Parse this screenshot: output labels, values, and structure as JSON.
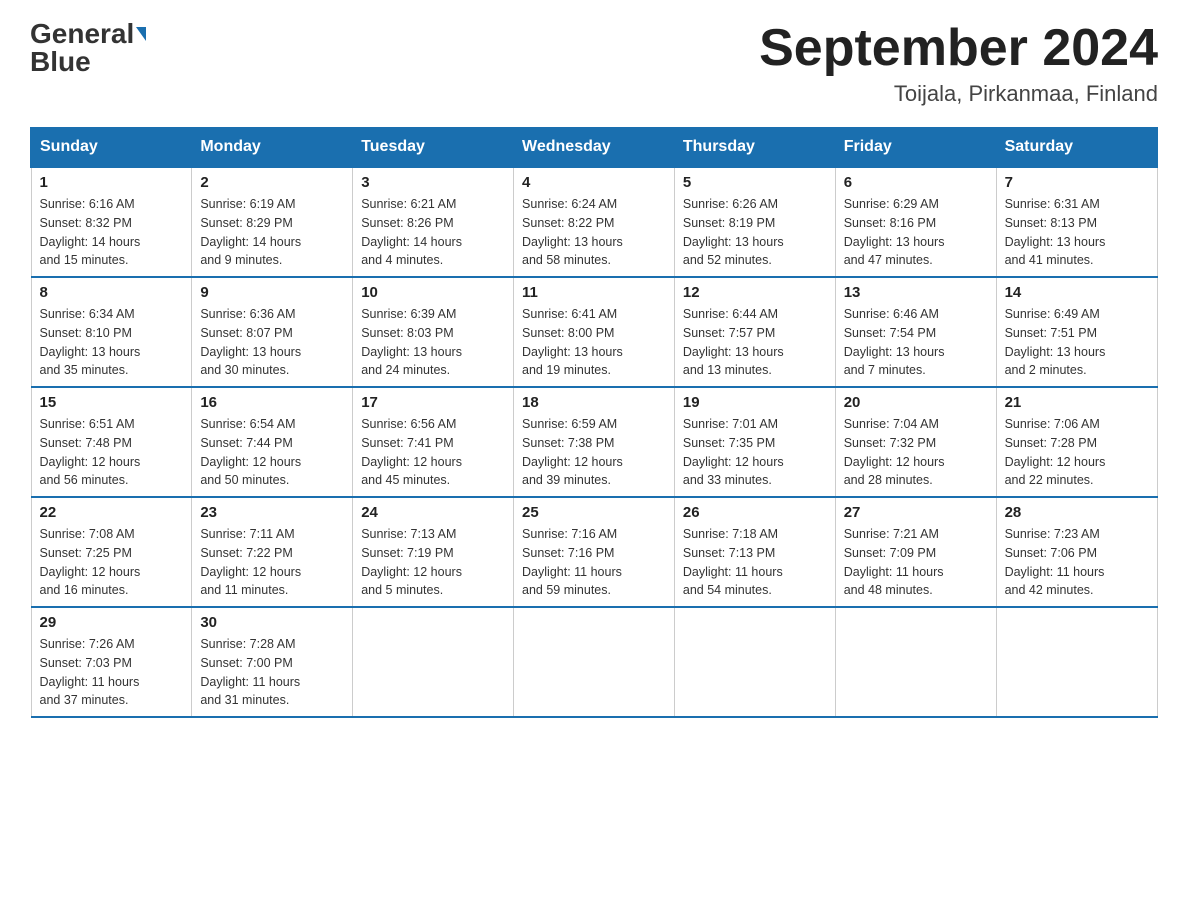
{
  "header": {
    "logo_main": "General",
    "logo_accent": "Blue",
    "month_title": "September 2024",
    "location": "Toijala, Pirkanmaa, Finland"
  },
  "days_of_week": [
    "Sunday",
    "Monday",
    "Tuesday",
    "Wednesday",
    "Thursday",
    "Friday",
    "Saturday"
  ],
  "weeks": [
    [
      {
        "day": "1",
        "sunrise": "6:16 AM",
        "sunset": "8:32 PM",
        "daylight": "14 hours and 15 minutes."
      },
      {
        "day": "2",
        "sunrise": "6:19 AM",
        "sunset": "8:29 PM",
        "daylight": "14 hours and 9 minutes."
      },
      {
        "day": "3",
        "sunrise": "6:21 AM",
        "sunset": "8:26 PM",
        "daylight": "14 hours and 4 minutes."
      },
      {
        "day": "4",
        "sunrise": "6:24 AM",
        "sunset": "8:22 PM",
        "daylight": "13 hours and 58 minutes."
      },
      {
        "day": "5",
        "sunrise": "6:26 AM",
        "sunset": "8:19 PM",
        "daylight": "13 hours and 52 minutes."
      },
      {
        "day": "6",
        "sunrise": "6:29 AM",
        "sunset": "8:16 PM",
        "daylight": "13 hours and 47 minutes."
      },
      {
        "day": "7",
        "sunrise": "6:31 AM",
        "sunset": "8:13 PM",
        "daylight": "13 hours and 41 minutes."
      }
    ],
    [
      {
        "day": "8",
        "sunrise": "6:34 AM",
        "sunset": "8:10 PM",
        "daylight": "13 hours and 35 minutes."
      },
      {
        "day": "9",
        "sunrise": "6:36 AM",
        "sunset": "8:07 PM",
        "daylight": "13 hours and 30 minutes."
      },
      {
        "day": "10",
        "sunrise": "6:39 AM",
        "sunset": "8:03 PM",
        "daylight": "13 hours and 24 minutes."
      },
      {
        "day": "11",
        "sunrise": "6:41 AM",
        "sunset": "8:00 PM",
        "daylight": "13 hours and 19 minutes."
      },
      {
        "day": "12",
        "sunrise": "6:44 AM",
        "sunset": "7:57 PM",
        "daylight": "13 hours and 13 minutes."
      },
      {
        "day": "13",
        "sunrise": "6:46 AM",
        "sunset": "7:54 PM",
        "daylight": "13 hours and 7 minutes."
      },
      {
        "day": "14",
        "sunrise": "6:49 AM",
        "sunset": "7:51 PM",
        "daylight": "13 hours and 2 minutes."
      }
    ],
    [
      {
        "day": "15",
        "sunrise": "6:51 AM",
        "sunset": "7:48 PM",
        "daylight": "12 hours and 56 minutes."
      },
      {
        "day": "16",
        "sunrise": "6:54 AM",
        "sunset": "7:44 PM",
        "daylight": "12 hours and 50 minutes."
      },
      {
        "day": "17",
        "sunrise": "6:56 AM",
        "sunset": "7:41 PM",
        "daylight": "12 hours and 45 minutes."
      },
      {
        "day": "18",
        "sunrise": "6:59 AM",
        "sunset": "7:38 PM",
        "daylight": "12 hours and 39 minutes."
      },
      {
        "day": "19",
        "sunrise": "7:01 AM",
        "sunset": "7:35 PM",
        "daylight": "12 hours and 33 minutes."
      },
      {
        "day": "20",
        "sunrise": "7:04 AM",
        "sunset": "7:32 PM",
        "daylight": "12 hours and 28 minutes."
      },
      {
        "day": "21",
        "sunrise": "7:06 AM",
        "sunset": "7:28 PM",
        "daylight": "12 hours and 22 minutes."
      }
    ],
    [
      {
        "day": "22",
        "sunrise": "7:08 AM",
        "sunset": "7:25 PM",
        "daylight": "12 hours and 16 minutes."
      },
      {
        "day": "23",
        "sunrise": "7:11 AM",
        "sunset": "7:22 PM",
        "daylight": "12 hours and 11 minutes."
      },
      {
        "day": "24",
        "sunrise": "7:13 AM",
        "sunset": "7:19 PM",
        "daylight": "12 hours and 5 minutes."
      },
      {
        "day": "25",
        "sunrise": "7:16 AM",
        "sunset": "7:16 PM",
        "daylight": "11 hours and 59 minutes."
      },
      {
        "day": "26",
        "sunrise": "7:18 AM",
        "sunset": "7:13 PM",
        "daylight": "11 hours and 54 minutes."
      },
      {
        "day": "27",
        "sunrise": "7:21 AM",
        "sunset": "7:09 PM",
        "daylight": "11 hours and 48 minutes."
      },
      {
        "day": "28",
        "sunrise": "7:23 AM",
        "sunset": "7:06 PM",
        "daylight": "11 hours and 42 minutes."
      }
    ],
    [
      {
        "day": "29",
        "sunrise": "7:26 AM",
        "sunset": "7:03 PM",
        "daylight": "11 hours and 37 minutes."
      },
      {
        "day": "30",
        "sunrise": "7:28 AM",
        "sunset": "7:00 PM",
        "daylight": "11 hours and 31 minutes."
      },
      null,
      null,
      null,
      null,
      null
    ]
  ],
  "labels": {
    "sunrise": "Sunrise:",
    "sunset": "Sunset:",
    "daylight": "Daylight:"
  }
}
